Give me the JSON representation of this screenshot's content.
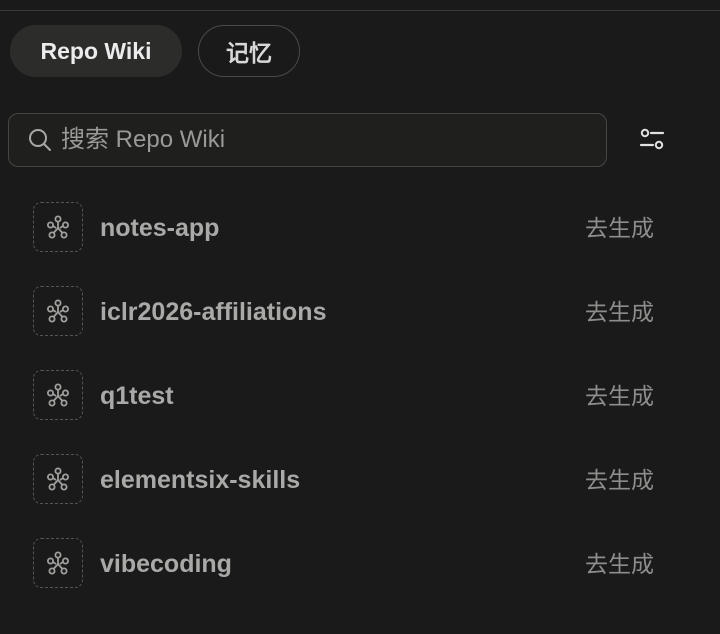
{
  "tabs": [
    {
      "label": "Repo Wiki",
      "active": true
    },
    {
      "label": "记忆",
      "active": false
    }
  ],
  "search": {
    "placeholder": "搜索 Repo Wiki",
    "value": "",
    "icon": "search-icon"
  },
  "filter": {
    "icon": "sliders-icon"
  },
  "repos": [
    {
      "name": "notes-app",
      "action": "去生成",
      "icon": "graph-icon"
    },
    {
      "name": "iclr2026-affiliations",
      "action": "去生成",
      "icon": "graph-icon"
    },
    {
      "name": "q1test",
      "action": "去生成",
      "icon": "graph-icon"
    },
    {
      "name": "elementsix-skills",
      "action": "去生成",
      "icon": "graph-icon"
    },
    {
      "name": "vibecoding",
      "action": "去生成",
      "icon": "graph-icon"
    }
  ],
  "colors": {
    "background": "#1a1a1a",
    "tab_active_bg": "#2c2c2b",
    "repo_text": "#a9a9a7",
    "action_text": "#8d8d8b"
  }
}
